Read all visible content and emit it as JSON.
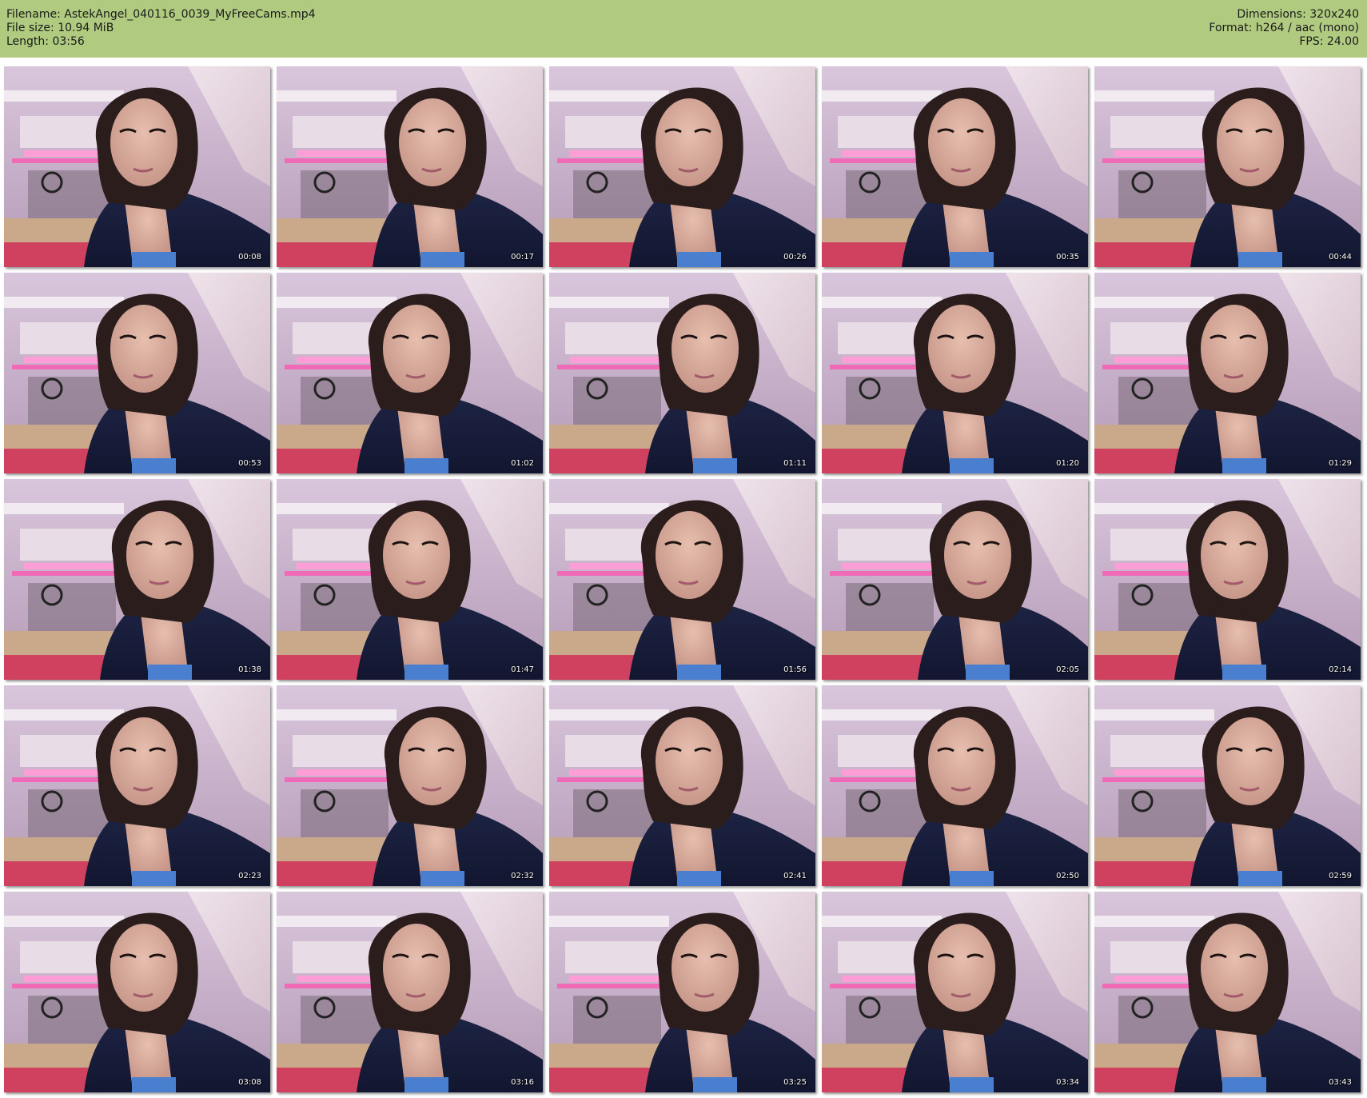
{
  "header": {
    "filename_line": "Filename: AstekAngel_040116_0039_MyFreeCams.mp4",
    "filesize_line": "File size: 10.94 MiB",
    "length_line": "Length: 03:56",
    "dimensions_line": "Dimensions: 320x240",
    "format_line": "Format: h264 / aac (mono)",
    "fps_line": "FPS: 24.00"
  },
  "colors": {
    "header_bg": "#b0cb80",
    "page_bg": "#ffffff"
  },
  "thumbnails": [
    {
      "time": "00:08"
    },
    {
      "time": "00:17"
    },
    {
      "time": "00:26"
    },
    {
      "time": "00:35"
    },
    {
      "time": "00:44"
    },
    {
      "time": "00:53"
    },
    {
      "time": "01:02"
    },
    {
      "time": "01:11"
    },
    {
      "time": "01:20"
    },
    {
      "time": "01:29"
    },
    {
      "time": "01:38"
    },
    {
      "time": "01:47"
    },
    {
      "time": "01:56"
    },
    {
      "time": "02:05"
    },
    {
      "time": "02:14"
    },
    {
      "time": "02:23"
    },
    {
      "time": "02:32"
    },
    {
      "time": "02:41"
    },
    {
      "time": "02:50"
    },
    {
      "time": "02:59"
    },
    {
      "time": "03:08"
    },
    {
      "time": "03:16"
    },
    {
      "time": "03:25"
    },
    {
      "time": "03:34"
    },
    {
      "time": "03:43"
    }
  ]
}
